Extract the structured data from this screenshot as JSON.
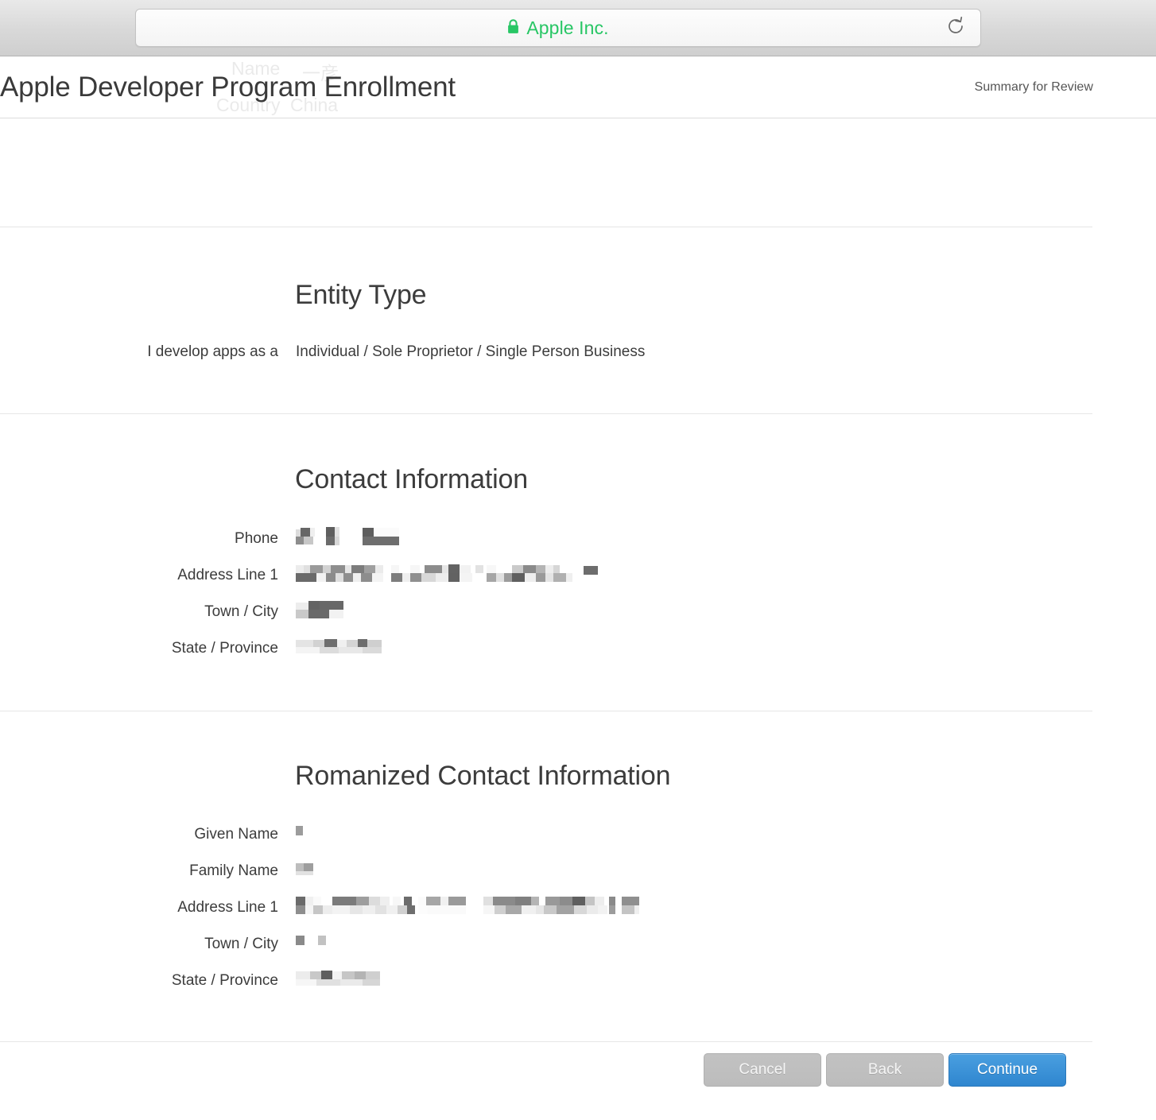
{
  "browser": {
    "identity_label": "Apple Inc.",
    "lock_icon": "lock-icon",
    "lock_color": "#28c665",
    "reload_icon": "reload-icon"
  },
  "header": {
    "title": "Apple Developer Program Enrollment",
    "step_label": "Summary for Review",
    "ghost_text": {
      "name_label": "Name",
      "name_value": "一彦",
      "country_label": "Country",
      "country_value": "China"
    }
  },
  "sections": [
    {
      "id": "entity-type",
      "title": "Entity Type",
      "fields": [
        {
          "label": "I develop apps as a",
          "value": "Individual / Sole Proprietor / Single Person Business",
          "redacted": false
        }
      ]
    },
    {
      "id": "contact-information",
      "title": "Contact Information",
      "fields": [
        {
          "label": "Phone",
          "value": "",
          "redacted": true,
          "blocks": "phone"
        },
        {
          "label": "Address Line 1",
          "value": "",
          "redacted": true,
          "blocks": "address"
        },
        {
          "label": "Town / City",
          "value": "",
          "redacted": true,
          "blocks": "city"
        },
        {
          "label": "State / Province",
          "value": "",
          "redacted": true,
          "blocks": "state"
        }
      ]
    },
    {
      "id": "romanized-contact-information",
      "title": "Romanized Contact Information",
      "fields": [
        {
          "label": "Given Name",
          "value": "",
          "redacted": true,
          "blocks": "given"
        },
        {
          "label": "Family Name",
          "value": "",
          "redacted": true,
          "blocks": "family"
        },
        {
          "label": "Address Line 1",
          "value": "",
          "redacted": true,
          "blocks": "raddress"
        },
        {
          "label": "Town / City",
          "value": "",
          "redacted": true,
          "blocks": "rcity"
        },
        {
          "label": "State / Province",
          "value": "",
          "redacted": true,
          "blocks": "rstate"
        }
      ]
    }
  ],
  "footer": {
    "buttons": [
      {
        "label": "Cancel",
        "style": "secondary",
        "name": "cancel-button"
      },
      {
        "label": "Back",
        "style": "secondary",
        "name": "back-button"
      },
      {
        "label": "Continue",
        "style": "primary",
        "name": "continue-button"
      }
    ]
  },
  "colors": {
    "accent_blue": "#2f86cf",
    "secure_green": "#28c665",
    "text": "#3c3c3c",
    "divider": "#e6e6e6"
  }
}
